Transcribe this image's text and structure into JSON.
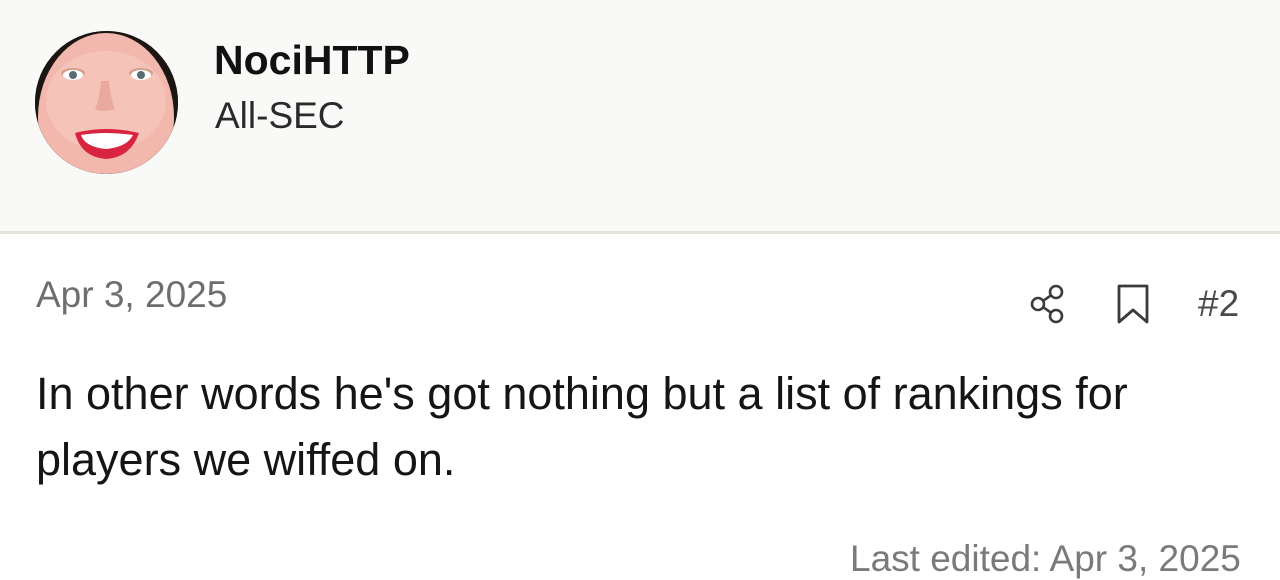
{
  "post": {
    "author": {
      "username": "NociHTTP",
      "title": "All-SEC",
      "avatar_icon": "user-avatar-photo"
    },
    "date": "Apr 3, 2025",
    "actions": {
      "share_icon": "share-icon",
      "bookmark_icon": "bookmark-icon",
      "post_number": "#2"
    },
    "body": "In other words he's got nothing but a list of rankings for players we wiffed on.",
    "edit_note": "Last edited: Apr 3, 2025"
  },
  "colors": {
    "header_background": "#f9f9f8",
    "divider": "#e3e3dc",
    "muted_text": "#6e6e6e"
  }
}
